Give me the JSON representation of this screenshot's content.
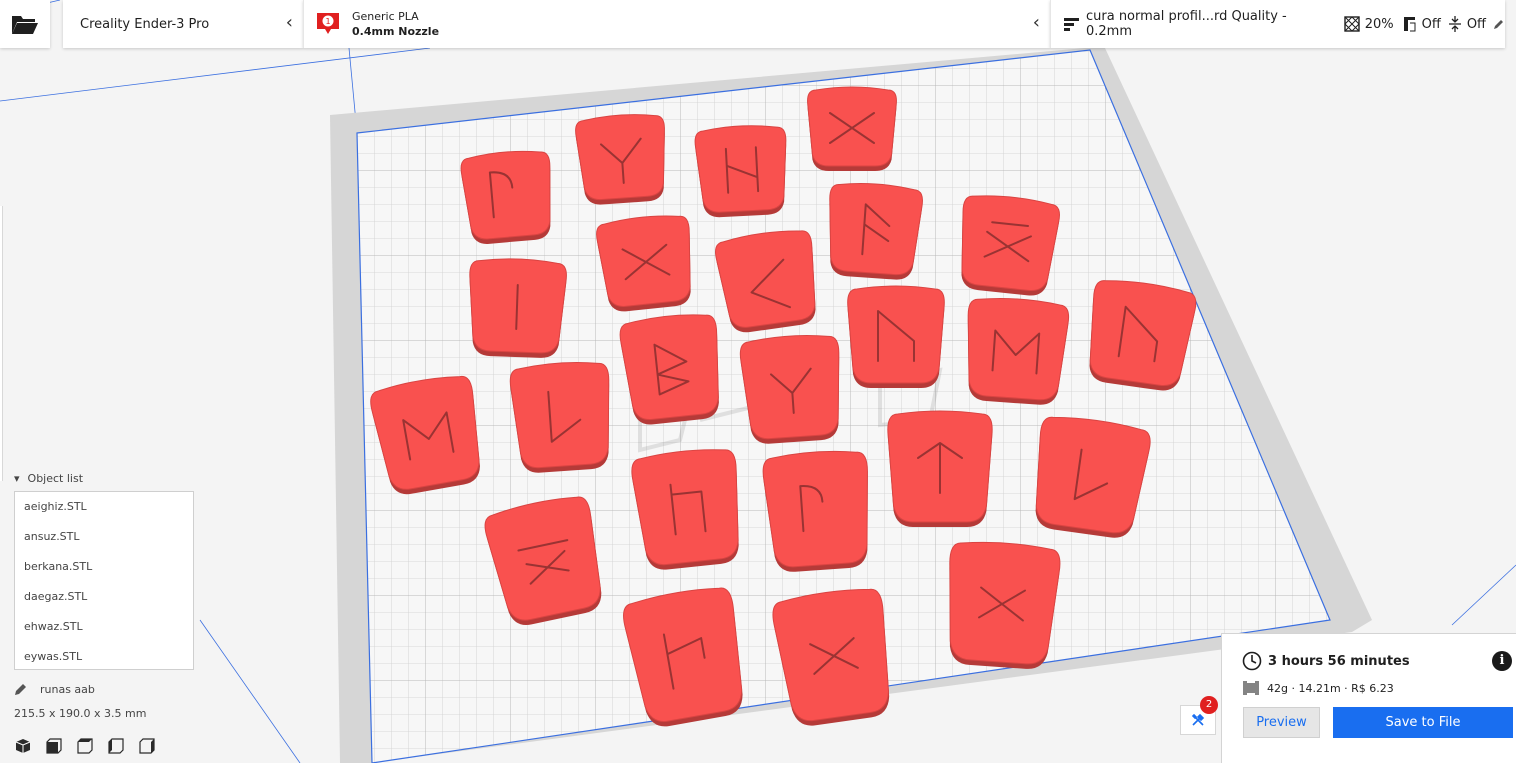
{
  "header": {
    "printer": {
      "name": "Creality Ender-3 Pro"
    },
    "material": {
      "extruder_number": "1",
      "name": "Generic PLA",
      "nozzle": "0.4mm Nozzle"
    },
    "profile": {
      "name": "cura normal profil...rd Quality - 0.2mm",
      "infill": "20%",
      "support": "Off",
      "adhesion": "Off"
    }
  },
  "sidebar": {
    "object_list": {
      "title": "Object list",
      "items": [
        {
          "name": "aeighiz.STL"
        },
        {
          "name": "ansuz.STL"
        },
        {
          "name": "berkana.STL"
        },
        {
          "name": "daegaz.STL"
        },
        {
          "name": "ehwaz.STL"
        },
        {
          "name": "eywas.STL"
        }
      ]
    },
    "project_name": "runas aab",
    "dimensions": "215.5 x 190.0 x 3.5 mm"
  },
  "job": {
    "time": "3 hours 56 minutes",
    "material": "42g · 14.21m · R$ 6.23",
    "preview_label": "Preview",
    "save_label": "Save to File",
    "tools_badge": "2"
  },
  "icons": {
    "open": "folder-open-icon",
    "profile": "profile-lines-icon",
    "infill": "infill-icon",
    "support": "support-icon",
    "adhesion": "adhesion-icon",
    "edit": "pencil-icon",
    "clock": "clock-icon",
    "spool": "spool-icon",
    "info": "info-icon",
    "tools": "tools-icon"
  },
  "colors": {
    "accent": "#196ef0",
    "model": "#f9514f",
    "badge": "#e02020",
    "buildplate_outline": "#3b6fe0"
  }
}
